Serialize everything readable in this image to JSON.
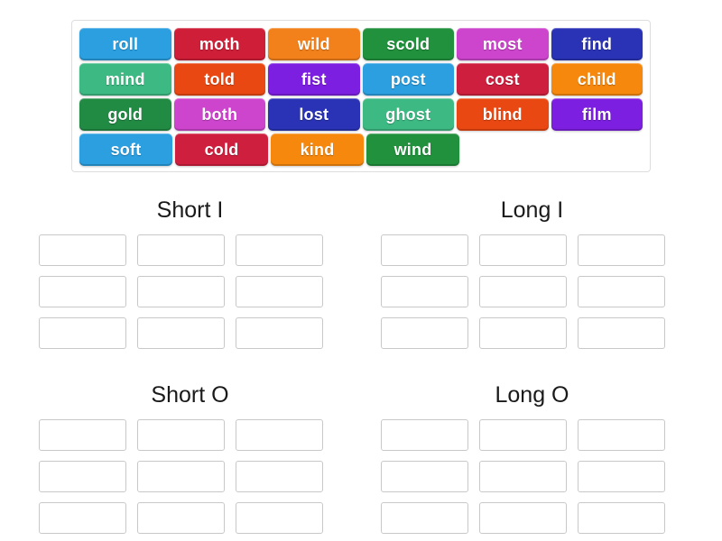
{
  "activity": {
    "type": "word-sort-drag-and-drop"
  },
  "word_bank": {
    "name": "word-bank",
    "rows": [
      [
        {
          "label": "roll",
          "color": "#2b9fe0"
        },
        {
          "label": "moth",
          "color": "#cf1f38"
        },
        {
          "label": "wild",
          "color": "#f2811b"
        },
        {
          "label": "scold",
          "color": "#21913d"
        },
        {
          "label": "most",
          "color": "#cd45cd"
        },
        {
          "label": "find",
          "color": "#2a33b5"
        }
      ],
      [
        {
          "label": "mind",
          "color": "#3dba83"
        },
        {
          "label": "told",
          "color": "#ea4812"
        },
        {
          "label": "fist",
          "color": "#7c1fe0"
        },
        {
          "label": "post",
          "color": "#2b9fe0"
        },
        {
          "label": "cost",
          "color": "#cf1f3e"
        },
        {
          "label": "child",
          "color": "#f6880e"
        }
      ],
      [
        {
          "label": "gold",
          "color": "#218b44"
        },
        {
          "label": "both",
          "color": "#cd45cd"
        },
        {
          "label": "lost",
          "color": "#2a33b5"
        },
        {
          "label": "ghost",
          "color": "#3dba83"
        },
        {
          "label": "blind",
          "color": "#ea4812"
        },
        {
          "label": "film",
          "color": "#7c1fe0"
        }
      ],
      [
        {
          "label": "soft",
          "color": "#2b9fe0"
        },
        {
          "label": "cold",
          "color": "#cf1f3e"
        },
        {
          "label": "kind",
          "color": "#f6880e"
        },
        {
          "label": "wind",
          "color": "#21913d"
        }
      ]
    ]
  },
  "categories": [
    {
      "title": "Short I",
      "slot_count": 9,
      "slots": [
        "",
        "",
        "",
        "",
        "",
        "",
        "",
        "",
        ""
      ]
    },
    {
      "title": "Long I",
      "slot_count": 9,
      "slots": [
        "",
        "",
        "",
        "",
        "",
        "",
        "",
        "",
        ""
      ]
    },
    {
      "title": "Short O",
      "slot_count": 9,
      "slots": [
        "",
        "",
        "",
        "",
        "",
        "",
        "",
        "",
        ""
      ]
    },
    {
      "title": "Long O",
      "slot_count": 9,
      "slots": [
        "",
        "",
        "",
        "",
        "",
        "",
        "",
        "",
        ""
      ]
    }
  ]
}
